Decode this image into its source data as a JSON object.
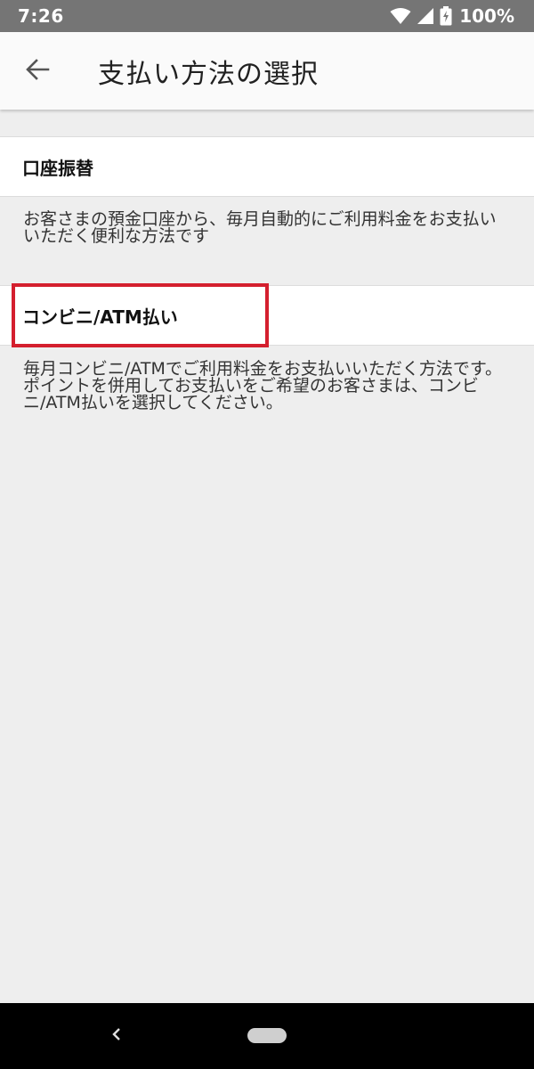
{
  "status_bar": {
    "time": "7:26",
    "battery": "100%"
  },
  "app_bar": {
    "title": "支払い方法の選択"
  },
  "options": [
    {
      "label": "口座振替",
      "description": [
        "お客さまの預金口座から、毎月自動的にご利用料金をお支払いいただく便利な方法です"
      ]
    },
    {
      "label": "コンビニ/ATM払い",
      "description": [
        "毎月コンビニ/ATMでご利用料金をお支払いいただく方法です。",
        "ポイントを併用してお支払いをご希望のお客さまは、コンビニ/ATM払いを選択してください。"
      ]
    }
  ],
  "colors": {
    "status_bar": "#757575",
    "app_bar": "#fafafa",
    "background": "#eeeeee",
    "highlight": "#d41f2e"
  },
  "icons": {
    "back": "arrow-left-icon",
    "wifi": "wifi-icon",
    "signal": "cell-signal-icon",
    "battery": "battery-charging-icon",
    "nav_back": "chevron-left-icon",
    "nav_home": "home-pill-icon"
  }
}
